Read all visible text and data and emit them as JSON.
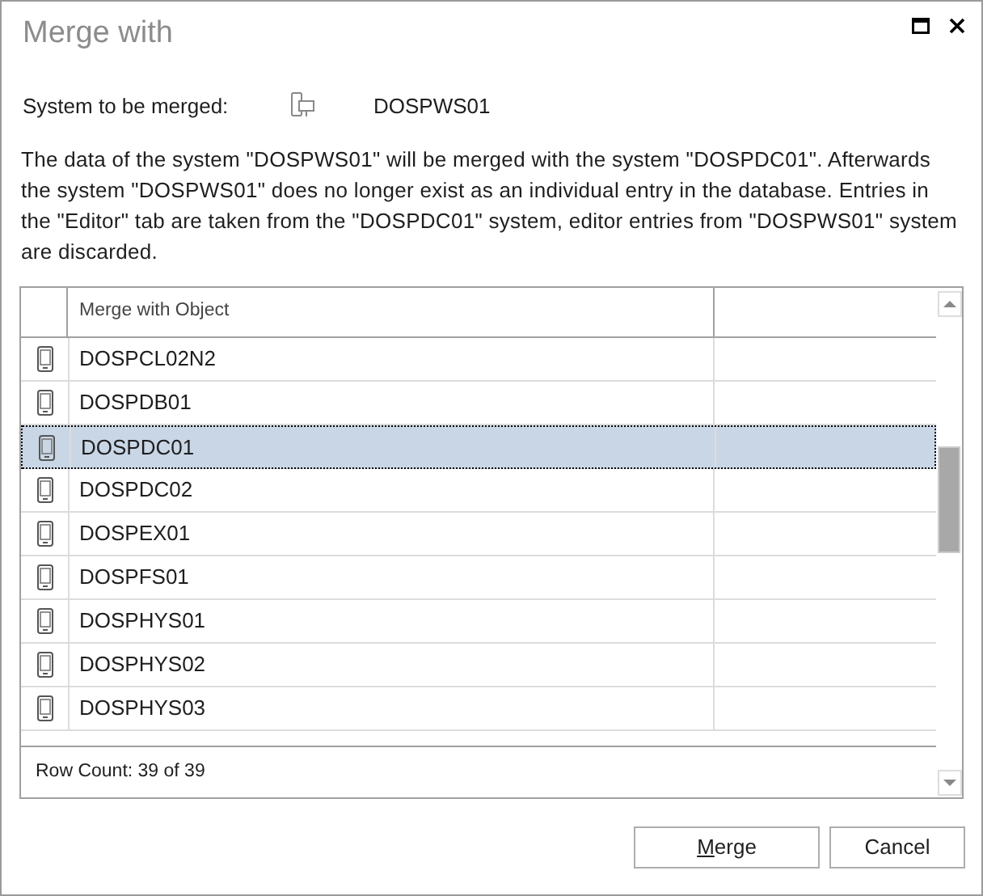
{
  "window": {
    "title": "Merge with"
  },
  "system": {
    "label": "System to be merged:",
    "value": "DOSPWS01"
  },
  "description": "The data of the system \"DOSPWS01\" will be merged with the system \"DOSPDC01\". Afterwards the system \"DOSPWS01\" does no longer exist as an individual entry in the database. Entries in the \"Editor\" tab are taken from the \"DOSPDC01\" system, editor entries from \"DOSPWS01\" system are discarded.",
  "table": {
    "columns": [
      "Merge with Object"
    ],
    "rows": [
      {
        "name": "DOSPCL02N2",
        "selected": false
      },
      {
        "name": "DOSPDB01",
        "selected": false
      },
      {
        "name": "DOSPDC01",
        "selected": true
      },
      {
        "name": "DOSPDC02",
        "selected": false
      },
      {
        "name": "DOSPEX01",
        "selected": false
      },
      {
        "name": "DOSPFS01",
        "selected": false
      },
      {
        "name": "DOSPHYS01",
        "selected": false
      },
      {
        "name": "DOSPHYS02",
        "selected": false
      },
      {
        "name": "DOSPHYS03",
        "selected": false
      }
    ],
    "row_count": "Row Count: 39 of 39"
  },
  "buttons": [
    {
      "label": "Merge",
      "accelerator": true
    },
    {
      "label": "Cancel"
    }
  ]
}
